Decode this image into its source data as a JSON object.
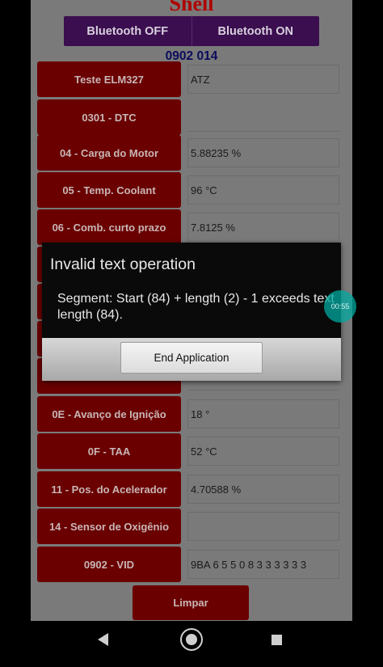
{
  "app": {
    "logo": "Shell",
    "bluetooth_off_label": "Bluetooth OFF",
    "bluetooth_on_label": "Bluetooth ON",
    "code_label": "0902 014",
    "clear_label": "Limpar"
  },
  "rows": [
    {
      "label": "Teste ELM327",
      "value": "ATZ"
    },
    {
      "label": "0301 - DTC",
      "value": ""
    },
    {
      "label": "04 - Carga do Motor",
      "value": "5.88235 %"
    },
    {
      "label": "05 - Temp. Coolant",
      "value": "96 °C"
    },
    {
      "label": "06 - Comb. curto prazo",
      "value": "7.8125  %"
    },
    {
      "label": "",
      "value": ""
    },
    {
      "label": "",
      "value": ""
    },
    {
      "label": "",
      "value": ""
    },
    {
      "label": "",
      "value": ""
    },
    {
      "label": "0E - Avanço de Ignição",
      "value": "18 °"
    },
    {
      "label": "0F - TAA",
      "value": "52  °C"
    },
    {
      "label": "11 - Pos. do Acelerador",
      "value": "4.70588  %"
    },
    {
      "label": "14 - Sensor de Oxigênio",
      "value": ""
    },
    {
      "label": "0902 - VID",
      "value": "9BA 6 5 5 0 8 3  3 3 3 3 3"
    }
  ],
  "dialog": {
    "title": "Invalid text operation",
    "message": "Segment: Start (84) + length (2) - 1 exceeds text length (84).",
    "button_label": "End Application"
  },
  "overlay": {
    "timer": "00:55"
  },
  "navbar": {
    "back_icon": "back-icon",
    "home_icon": "home-icon",
    "recents_icon": "recents-icon"
  }
}
